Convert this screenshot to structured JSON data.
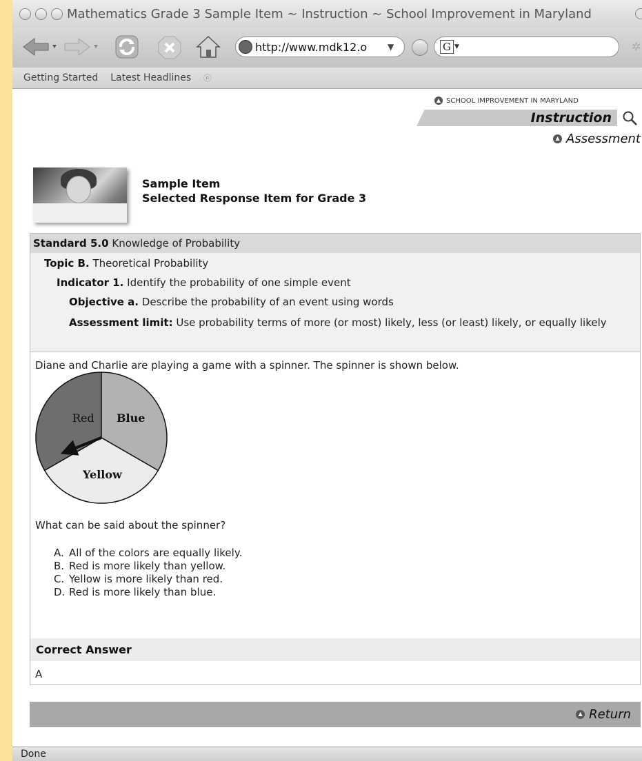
{
  "window": {
    "title": "Mathematics Grade 3 Sample Item ~ Instruction ~ School Improvement in Maryland"
  },
  "toolbar": {
    "url": "http://www.mdk12.o",
    "search_placeholder": ""
  },
  "bookmarks": [
    "Getting Started",
    "Latest Headlines"
  ],
  "site": {
    "org": "SCHOOL IMPROVEMENT IN MARYLAND",
    "section": "Instruction",
    "subsection": "Assessment"
  },
  "item": {
    "title": "Sample Item",
    "subtitle": "Selected Response Item for Grade 3"
  },
  "standard": {
    "standard_label": "Standard 5.0",
    "standard_text": "Knowledge of Probability",
    "topic_label": "Topic B.",
    "topic_text": "Theoretical Probability",
    "indicator_label": "Indicator 1.",
    "indicator_text": "Identify the probability of one simple event",
    "objective_label": "Objective a.",
    "objective_text": "Describe the probability of an event using words",
    "limit_label": "Assessment limit:",
    "limit_text": "Use probability terms of more (or most) likely, less (or least) likely, or equally likely"
  },
  "question": {
    "stem": "Diane and Charlie are playing a game with a spinner. The spinner is shown below.",
    "spinner": {
      "sections": [
        {
          "label": "Red",
          "color": "#6e6e6e"
        },
        {
          "label": "Blue",
          "color": "#b2b2b2"
        },
        {
          "label": "Yellow",
          "color": "#ececec"
        }
      ]
    },
    "ask": "What can be said about the spinner?",
    "choices": [
      {
        "letter": "A.",
        "text": "All of the colors are equally likely."
      },
      {
        "letter": "B.",
        "text": "Red is more likely than yellow."
      },
      {
        "letter": "C.",
        "text": "Yellow is more likely than red."
      },
      {
        "letter": "D.",
        "text": "Red is more likely than blue."
      }
    ]
  },
  "answer": {
    "heading": "Correct Answer",
    "value": "A"
  },
  "footer": {
    "return_label": "Return"
  },
  "status": {
    "text": "Done"
  }
}
